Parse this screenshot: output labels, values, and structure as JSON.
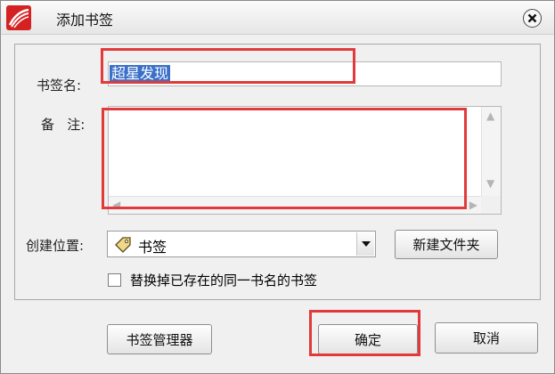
{
  "dialog": {
    "title": "添加书签",
    "bookmark_name_label": "书签名:",
    "bookmark_name_value": "超星发现",
    "note_label": "备   注:",
    "note_value": "",
    "location_label": "创建位置:",
    "location_value": "书签",
    "new_folder_button": "新建文件夹",
    "replace_checkbox_label": "替换掉已存在的同一书名的书签",
    "replace_checked": false,
    "manager_button": "书签管理器",
    "ok_button": "确定",
    "cancel_button": "取消"
  },
  "colors": {
    "annotation_red": "#e23a3a",
    "selection_blue": "#3b70c9",
    "logo_red": "#d42222"
  }
}
